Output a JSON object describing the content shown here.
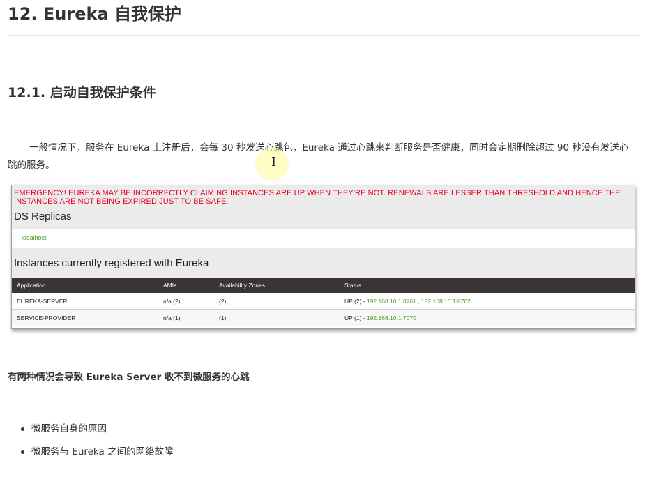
{
  "heading1": "12. Eureka 自我保护",
  "heading2": "12.1. 启动自我保护条件",
  "paragraph": "一般情况下，服务在 Eureka 上注册后，会每 30 秒发送心跳包，Eureka 通过心跳来判断服务是否健康，同时会定期删除超过 90 秒没有发送心跳的服务。",
  "eureka_screenshot": {
    "emergency": "EMERGENCY! EUREKA MAY BE INCORRECTLY CLAIMING INSTANCES ARE UP WHEN THEY'RE NOT. RENEWALS ARE LESSER THAN THRESHOLD AND HENCE THE INSTANCES ARE NOT BEING EXPIRED JUST TO BE SAFE.",
    "ds_replicas_title": "DS Replicas",
    "replica": "localhost",
    "instances_title": "Instances currently registered with Eureka",
    "columns": [
      "Application",
      "AMIs",
      "Availability Zones",
      "Status"
    ],
    "rows": [
      {
        "application": "EUREKA-SERVER",
        "amis": "n/a (2)",
        "zones": "(2)",
        "status_prefix": "UP (2) - ",
        "status_links": "192.168.10.1:8761 , 192.168.10.1:8762"
      },
      {
        "application": "SERVICE-PROVIDER",
        "amis": "n/a (1)",
        "zones": "(1)",
        "status_prefix": "UP (1) - ",
        "status_links": "192.168.10.1:7070"
      }
    ]
  },
  "bold_line": "有两种情况会导致 Eureka Server 收不到微服务的心跳",
  "list": [
    "微服务自身的原因",
    "微服务与 Eureka 之间的网络故障"
  ],
  "colors": {
    "emergency": "#e8001c",
    "link_green": "#4c9e25",
    "table_header": "#3a3432"
  },
  "icons": {
    "cursor": "text-cursor-icon"
  }
}
